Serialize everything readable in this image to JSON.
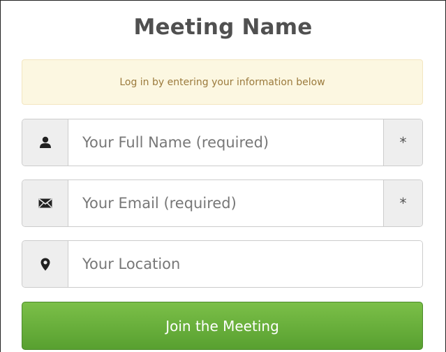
{
  "title": "Meeting Name",
  "notice": "Log in by entering your information below",
  "fields": {
    "name": {
      "placeholder": "Your Full Name (required)",
      "value": "",
      "required_marker": "*",
      "icon": "user-icon"
    },
    "email": {
      "placeholder": "Your Email (required)",
      "value": "",
      "required_marker": "*",
      "icon": "envelope-icon"
    },
    "location": {
      "placeholder": "Your Location",
      "value": "",
      "icon": "map-marker-icon"
    }
  },
  "join_button": "Join the Meeting",
  "colors": {
    "title": "#505050",
    "notice_bg": "#fcf7e1",
    "notice_text": "#9b7a3c",
    "button_green": "#6cb33f"
  }
}
